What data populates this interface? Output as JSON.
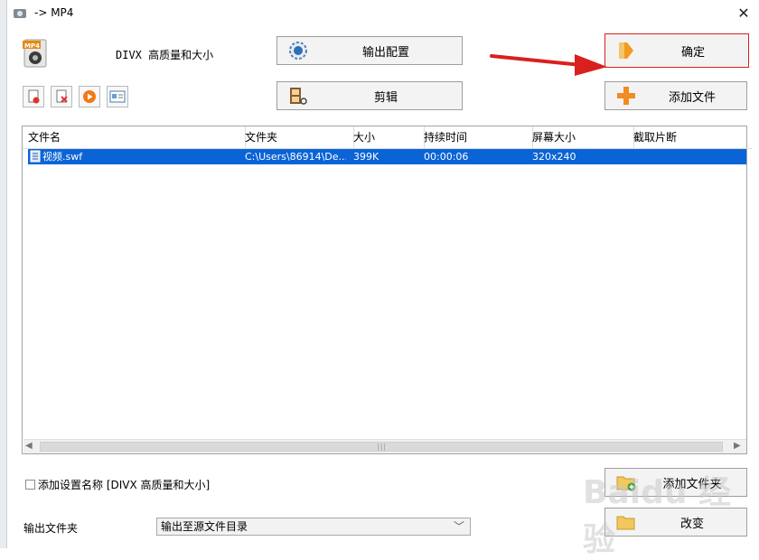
{
  "window": {
    "title": "-> MP4",
    "close_icon": "close-icon"
  },
  "format": {
    "icon_label": "MP4",
    "preset": "DIVX 高质量和大小"
  },
  "buttons": {
    "output_config": "输出配置",
    "confirm": "确定",
    "edit": "剪辑",
    "add_file": "添加文件",
    "add_folder": "添加文件夹",
    "change": "改变"
  },
  "toolbar": {
    "icons": [
      "remove-file-icon",
      "clear-list-icon",
      "play-icon",
      "media-info-icon"
    ]
  },
  "file_list": {
    "columns": [
      "文件名",
      "文件夹",
      "大小",
      "持续时间",
      "屏幕大小",
      "截取片断"
    ],
    "rows": [
      {
        "name": "视频.swf",
        "folder": "C:\\Users\\86914\\De...",
        "size": "399K",
        "duration": "00:00:06",
        "screen": "320x240",
        "clip": ""
      }
    ]
  },
  "options": {
    "add_setting_name": "添加设置名称 [DIVX 高质量和大小]",
    "add_setting_checked": false,
    "output_folder_label": "输出文件夹",
    "output_folder_value": "输出至源文件目录"
  },
  "colors": {
    "selection": "#0a64d6",
    "annotation_arrow": "#d9201f",
    "watermark": "#c8c8c8"
  },
  "watermark": "Baidu 经验"
}
